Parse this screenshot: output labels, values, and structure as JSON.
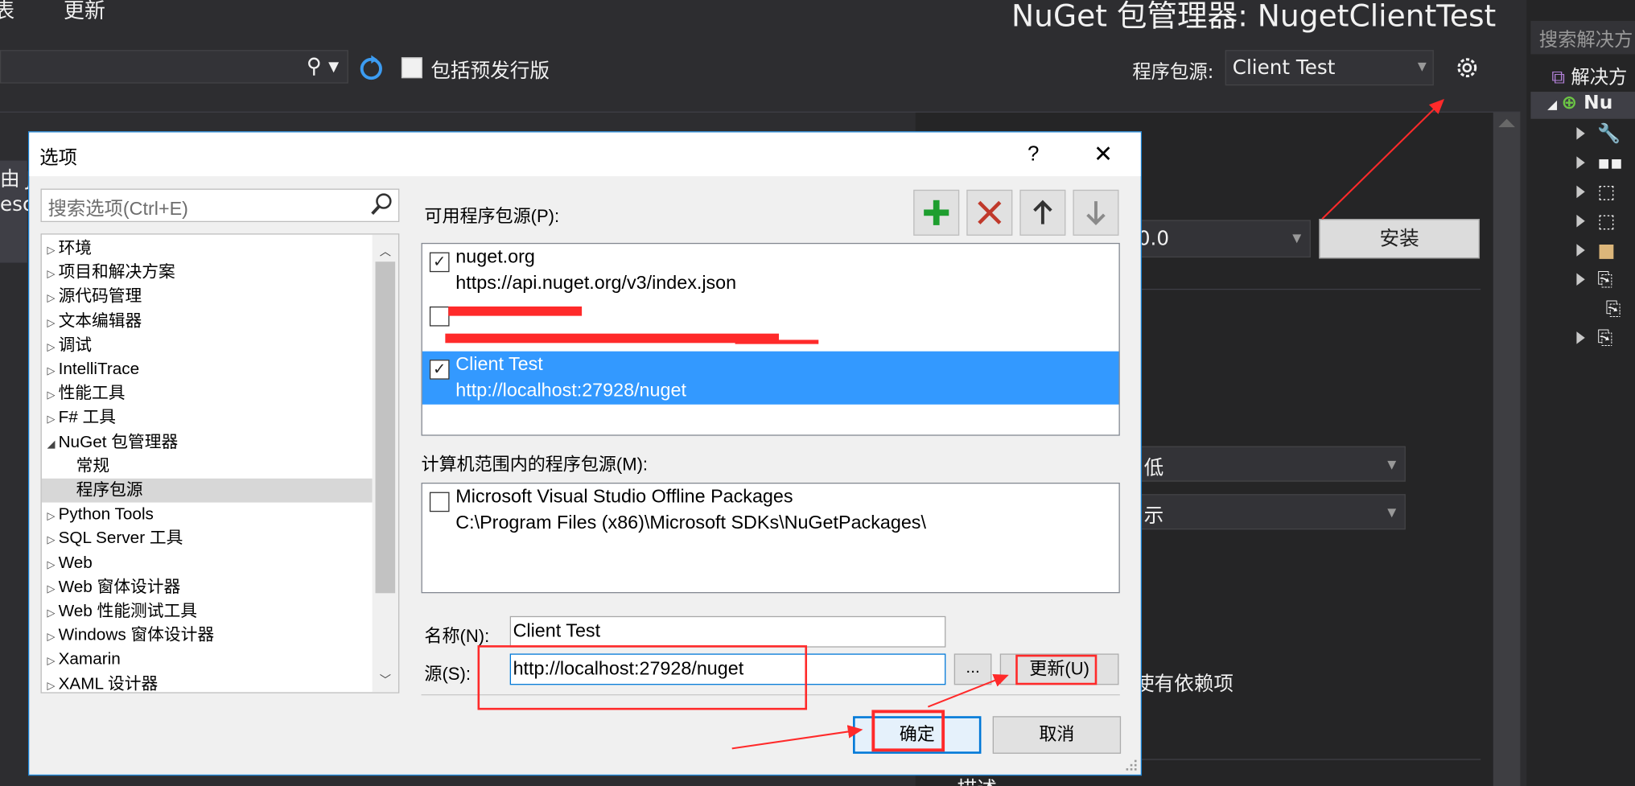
{
  "ide": {
    "menu_left_fragment": "表",
    "menu_update": "更新",
    "title": "NuGet 包管理器: NugetClientTest",
    "prerelease_label": "包括预发行版",
    "package_source_label": "程序包源:",
    "package_source_value": "Client Test",
    "left_pane_line1": "由 J",
    "left_pane_line2": "escr",
    "version_value": "0.0",
    "install_label": "安装",
    "dependency_select1": "低",
    "dependency_select2": "示",
    "dependency_text": "使有依赖项",
    "bottom_text": "描述"
  },
  "solution_explorer": {
    "search_placeholder": "搜索解决方",
    "solution_row": "解决方",
    "project_row": "Nu"
  },
  "dialog": {
    "title": "选项",
    "help_label": "?",
    "close_label": "✕",
    "search_placeholder": "搜索选项(Ctrl+E)",
    "tree": [
      {
        "label": "环境",
        "expanded": false,
        "child": false
      },
      {
        "label": "项目和解决方案",
        "expanded": false,
        "child": false
      },
      {
        "label": "源代码管理",
        "expanded": false,
        "child": false
      },
      {
        "label": "文本编辑器",
        "expanded": false,
        "child": false
      },
      {
        "label": "调试",
        "expanded": false,
        "child": false
      },
      {
        "label": "IntelliTrace",
        "expanded": false,
        "child": false
      },
      {
        "label": "性能工具",
        "expanded": false,
        "child": false
      },
      {
        "label": "F# 工具",
        "expanded": false,
        "child": false
      },
      {
        "label": "NuGet 包管理器",
        "expanded": true,
        "child": false
      },
      {
        "label": "常规",
        "expanded": false,
        "child": true
      },
      {
        "label": "程序包源",
        "expanded": false,
        "child": true,
        "selected": true
      },
      {
        "label": "Python Tools",
        "expanded": false,
        "child": false
      },
      {
        "label": "SQL Server 工具",
        "expanded": false,
        "child": false
      },
      {
        "label": "Web",
        "expanded": false,
        "child": false
      },
      {
        "label": "Web 窗体设计器",
        "expanded": false,
        "child": false
      },
      {
        "label": "Web 性能测试工具",
        "expanded": false,
        "child": false
      },
      {
        "label": "Windows 窗体设计器",
        "expanded": false,
        "child": false
      },
      {
        "label": "Xamarin",
        "expanded": false,
        "child": false
      },
      {
        "label": "XAML 设计器",
        "expanded": false,
        "child": false
      }
    ],
    "available_label": "可用程序包源(P):",
    "available_sources": [
      {
        "name": "nuget.org",
        "url": "https://api.nuget.org/v3/index.json",
        "checked": true,
        "selected": false
      },
      {
        "name": "",
        "url": "",
        "checked": false,
        "selected": false,
        "redacted": true
      },
      {
        "name": "Client Test",
        "url": "http://localhost:27928/nuget",
        "checked": true,
        "selected": true
      }
    ],
    "machine_label": "计算机范围内的程序包源(M):",
    "machine_sources": [
      {
        "name": "Microsoft Visual Studio Offline Packages",
        "url": "C:\\Program Files (x86)\\Microsoft SDKs\\NuGetPackages\\",
        "checked": false
      }
    ],
    "name_label": "名称(N):",
    "name_value": "Client Test",
    "source_label": "源(S):",
    "source_value": "http://localhost:27928/nuget",
    "browse_label": "...",
    "update_label": "更新(U)",
    "ok_label": "确定",
    "cancel_label": "取消"
  },
  "colors": {
    "ide_bg": "#2d2d30",
    "dialog_accent": "#1883d7",
    "selection": "#3399ff",
    "annotation": "#ff2a2a"
  }
}
